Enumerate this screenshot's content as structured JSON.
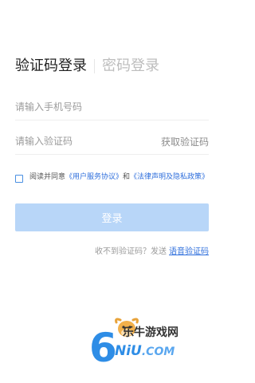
{
  "tabs": {
    "code_login": "验证码登录",
    "password_login": "密码登录"
  },
  "phone": {
    "placeholder": "请输入手机号码"
  },
  "code": {
    "placeholder": "请输入验证码",
    "get_code": "获取验证码"
  },
  "agreement": {
    "prefix": "阅读并同意",
    "user_agreement": "《用户服务协议》",
    "and": "和",
    "legal_privacy": "《法律声明及隐私政策》"
  },
  "login_button": "登录",
  "voice": {
    "hint": "收不到验证码？发送",
    "link": "语音验证码"
  },
  "watermark": {
    "digit": "6",
    "brand": "乐牛游戏网",
    "domain_main": "NiU",
    "domain_suffix": ".COM"
  },
  "colors": {
    "link": "#2f6fdc",
    "button_disabled": "#b8d6f8",
    "checkbox_border": "#4a90e2"
  },
  "icons": {
    "watermark_logo": "cow-mascot-icon"
  }
}
